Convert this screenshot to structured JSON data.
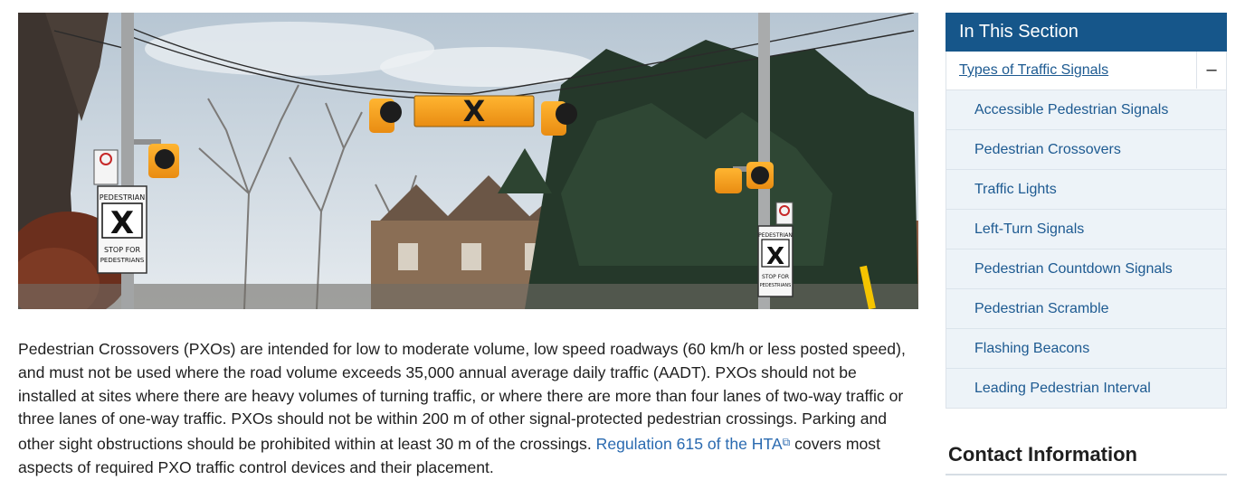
{
  "hero": {
    "sign_top_text": "PEDESTRIAN",
    "sign_mark": "X",
    "sign_bottom_text_1": "STOP FOR",
    "sign_bottom_text_2": "PEDESTRIANS",
    "overhead_mark": "X"
  },
  "article": {
    "text_before_link": "Pedestrian Crossovers (PXOs) are intended for low to moderate volume, low speed roadways (60 km/h or less posted speed), and must not be used where the road volume exceeds 35,000 annual average daily traffic (AADT). PXOs should not be installed at sites where there are heavy volumes of turning traffic, or where there are more than four lanes of two-way traffic or three lanes of one-way traffic. PXOs should not be within 200 m of other signal-protected pedestrian crossings. Parking and other sight obstructions should be prohibited within at least 30 m of the crossings. ",
    "link_text": "Regulation 615 of the HTA",
    "link_icon": "external-link-icon",
    "text_after_link": " covers most aspects of required PXO traffic control devices and their placement."
  },
  "sidebar": {
    "title": "In This Section",
    "section_label": "Types of Traffic Signals",
    "toggle_symbol": "–",
    "items": [
      {
        "label": "Accessible Pedestrian Signals"
      },
      {
        "label": "Pedestrian Crossovers"
      },
      {
        "label": "Traffic Lights"
      },
      {
        "label": "Left-Turn Signals"
      },
      {
        "label": "Pedestrian Countdown Signals"
      },
      {
        "label": "Pedestrian Scramble"
      },
      {
        "label": "Flashing Beacons"
      },
      {
        "label": "Leading Pedestrian Interval"
      }
    ]
  },
  "contact": {
    "title": "Contact Information"
  }
}
